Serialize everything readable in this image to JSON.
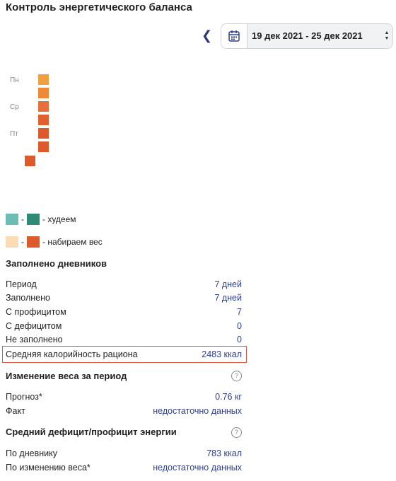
{
  "title": "Контроль энергетического баланса",
  "date_range": "19 дек 2021 - 25 дек 2021",
  "icons": {
    "prev": "chevron-left-icon",
    "calendar": "calendar-icon",
    "select": "select-arrows-icon",
    "help": "question-circle-icon"
  },
  "calendar": {
    "day_labels": [
      "Пн",
      "Ср",
      "Пт"
    ],
    "days": [
      {
        "color": "#f0a040"
      },
      {
        "color": "#ec8a38"
      },
      {
        "color": "#e5703a"
      },
      {
        "color": "#e06030"
      },
      {
        "color": "#dc5a2c"
      },
      {
        "color": "#dc5a2c"
      },
      {
        "color": "#dc5a2c"
      }
    ]
  },
  "legend": {
    "lose": {
      "text": "- худеем",
      "colors": [
        "#6ebdb5",
        "#2e8a77"
      ]
    },
    "gain": {
      "text": "- набираем вес",
      "colors": [
        "#fbdcb4",
        "#dc5a2c"
      ]
    }
  },
  "diaries": {
    "heading": "Заполнено дневников",
    "rows": [
      {
        "label": "Период",
        "value": "7 дней"
      },
      {
        "label": "Заполнено",
        "value": "7 дней"
      },
      {
        "label": "С профицитом",
        "value": "7"
      },
      {
        "label": "С дефицитом",
        "value": "0"
      },
      {
        "label": "Не заполнено",
        "value": "0"
      },
      {
        "label": "Средняя калорийность рациона",
        "value": "2483 ккал"
      }
    ]
  },
  "weight": {
    "heading": "Изменение веса за период",
    "rows": [
      {
        "label": "Прогноз*",
        "value": "0.76 кг"
      },
      {
        "label": "Факт",
        "value": "недостаточно данных"
      }
    ]
  },
  "energy": {
    "heading": "Средний дефицит/профицит энергии",
    "rows": [
      {
        "label": "По дневнику",
        "value": "783 ккал"
      },
      {
        "label": "По изменению веса*",
        "value": "недостаточно данных"
      }
    ]
  }
}
